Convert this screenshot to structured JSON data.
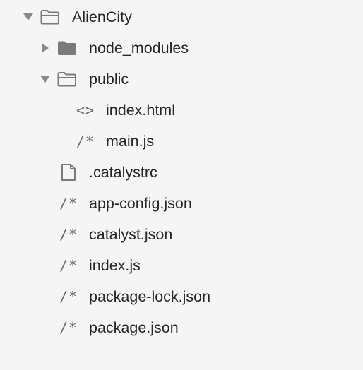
{
  "tree": {
    "root": {
      "label": "AlienCity",
      "expanded": true,
      "icon": "folder-open-icon"
    },
    "node_modules": {
      "label": "node_modules",
      "expanded": false,
      "icon": "folder-filled-icon"
    },
    "public": {
      "label": "public",
      "expanded": true,
      "icon": "folder-open-icon",
      "children": [
        {
          "label": "index.html",
          "icon": "html-code-icon",
          "glyph": "<>"
        },
        {
          "label": "main.js",
          "icon": "js-comment-icon",
          "glyph": "/*"
        }
      ]
    },
    "files": [
      {
        "label": ".catalystrc",
        "icon": "document-icon"
      },
      {
        "label": "app-config.json",
        "icon": "json-comment-icon",
        "glyph": "/*"
      },
      {
        "label": "catalyst.json",
        "icon": "json-comment-icon",
        "glyph": "/*"
      },
      {
        "label": "index.js",
        "icon": "js-comment-icon",
        "glyph": "/*"
      },
      {
        "label": "package-lock.json",
        "icon": "json-comment-icon",
        "glyph": "/*"
      },
      {
        "label": "package.json",
        "icon": "json-comment-icon",
        "glyph": "/*"
      }
    ]
  },
  "colors": {
    "background": "#f5f5f5",
    "text": "#262626",
    "icon": "#6d6d6d",
    "disclosure": "#8a8a8a"
  }
}
